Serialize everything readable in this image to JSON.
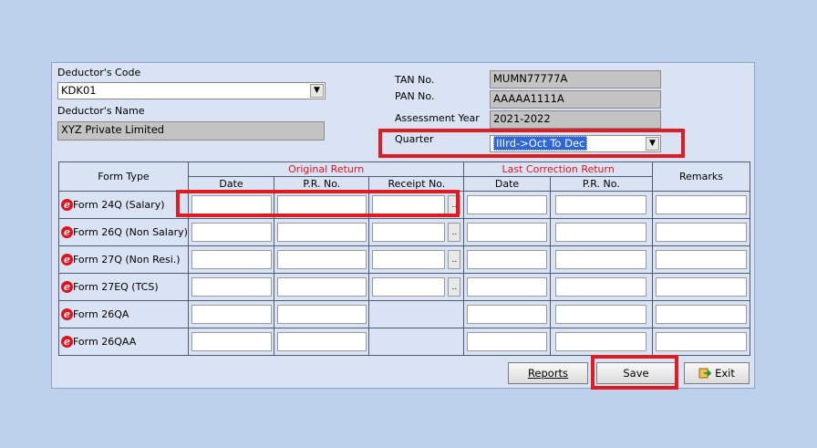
{
  "form": {
    "deductor_code_label": "Deductor's Code",
    "deductor_code_value": "KDK01",
    "deductor_name_label": "Deductor's Name",
    "deductor_name_value": "XYZ Private Limited",
    "tan_label": "TAN No.",
    "tan_value": "MUMN77777A",
    "pan_label": "PAN No.",
    "pan_value": "AAAAA1111A",
    "ay_label": "Assessment Year",
    "ay_value": "2021-2022",
    "quarter_label": "Quarter",
    "quarter_value": "IIIrd->Oct To Dec"
  },
  "table": {
    "form_type_header": "Form Type",
    "original_return_header": "Original Return",
    "last_correction_header": "Last Correction Return",
    "remarks_header": "Remarks",
    "date_header": "Date",
    "pr_header": "P.R. No.",
    "receipt_header": "Receipt No.",
    "rows": [
      {
        "label": "Form 24Q (Salary)",
        "has_receipt": true
      },
      {
        "label": "Form 26Q (Non Salary)",
        "has_receipt": true
      },
      {
        "label": "Form 27Q (Non Resi.)",
        "has_receipt": true
      },
      {
        "label": "Form 27EQ (TCS)",
        "has_receipt": true
      },
      {
        "label": "Form 26QA",
        "has_receipt": false
      },
      {
        "label": "Form 26QAA",
        "has_receipt": false
      }
    ],
    "browse_label": ".."
  },
  "buttons": {
    "reports": "Reports",
    "save": "Save",
    "exit": "Exit"
  },
  "icons": {
    "form_icon": "e-icon",
    "dropdown": "chevron-down-icon",
    "exit": "exit-icon"
  },
  "colors": {
    "accent_red": "#e11b22",
    "group_header_red": "#e0141e",
    "selection_blue": "#2f67d9"
  }
}
